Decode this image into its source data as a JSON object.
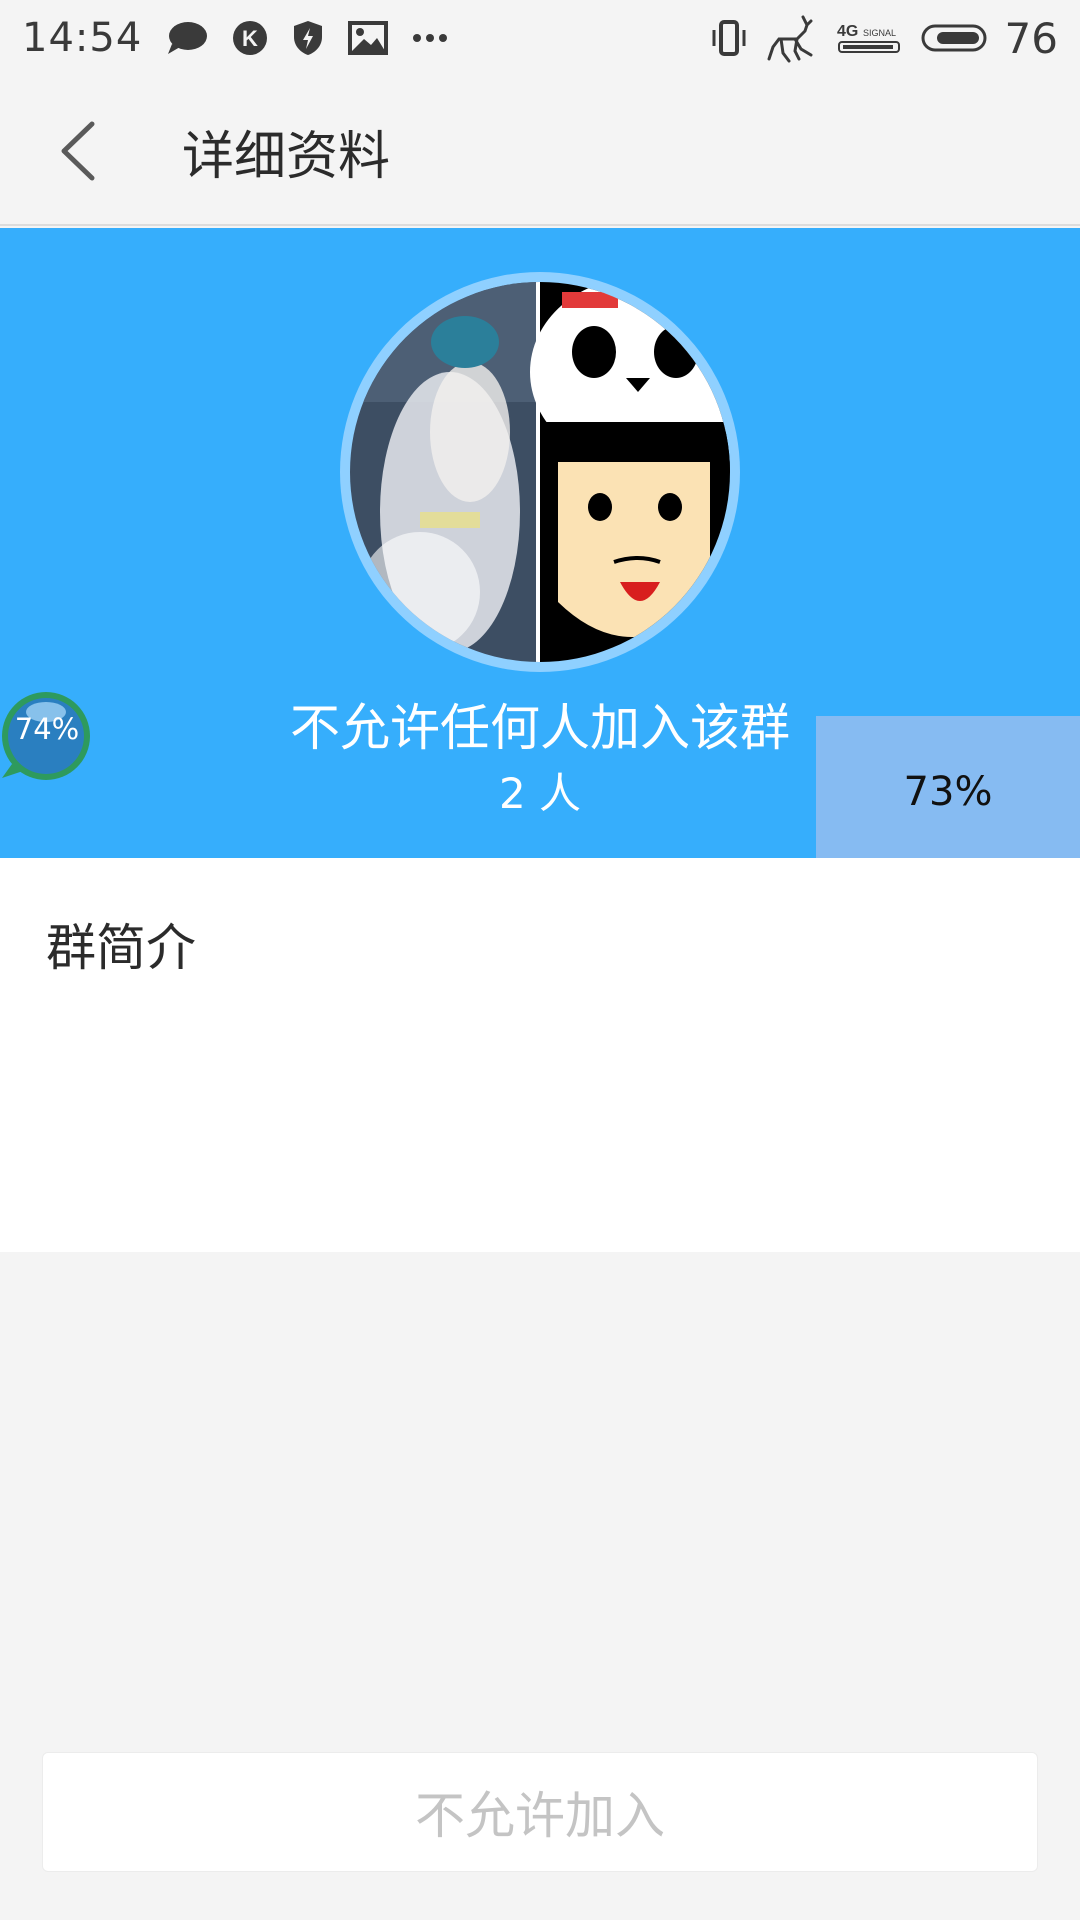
{
  "status_bar": {
    "time": "14:54",
    "left_icons": [
      "chat-bubble-icon",
      "k-badge-icon",
      "shield-bolt-icon",
      "image-icon",
      "more-dots-icon"
    ],
    "right_icons": [
      "vibrate-icon",
      "deer-icon",
      "4g-signal-icon",
      "battery-icon"
    ],
    "battery": "76"
  },
  "header": {
    "title": "详细资料",
    "back_icon": "chevron-left-icon"
  },
  "group": {
    "name": "不允许任何人加入该群",
    "member_count": "2 人"
  },
  "overlays": {
    "bubble_percent": "74%",
    "box_percent": "73%"
  },
  "intro": {
    "title": "群简介"
  },
  "footer": {
    "join_button": "不允许加入"
  },
  "colors": {
    "hero_bg": "#36aefc",
    "page_bg": "#f4f4f4",
    "button_text_disabled": "#c4c4c4"
  }
}
